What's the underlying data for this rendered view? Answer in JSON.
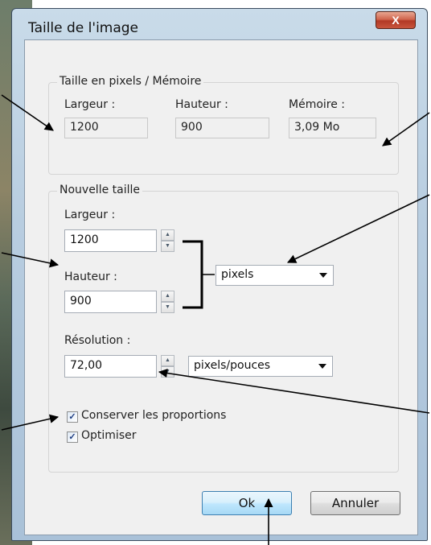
{
  "window": {
    "title": "Taille de l'image",
    "close_glyph": "X"
  },
  "pixels_group": {
    "legend": "Taille en pixels / Mémoire",
    "width_label": "Largeur :",
    "width_value": "1200",
    "height_label": "Hauteur :",
    "height_value": "900",
    "memory_label": "Mémoire :",
    "memory_value": "3,09 Mo"
  },
  "new_size_group": {
    "legend": "Nouvelle taille",
    "width_label": "Largeur :",
    "width_value": "1200",
    "height_label": "Hauteur :",
    "height_value": "900",
    "unit_selected": "pixels",
    "resolution_label": "Résolution :",
    "resolution_value": "72,00",
    "resolution_unit_selected": "pixels/pouces",
    "keep_proportions_label": "Conserver les proportions",
    "keep_proportions_checked": true,
    "optimize_label": "Optimiser",
    "optimize_checked": true
  },
  "buttons": {
    "ok": "Ok",
    "cancel": "Annuler"
  },
  "icons": {
    "spin_up": "▲",
    "spin_down": "▼",
    "check": "✓"
  }
}
